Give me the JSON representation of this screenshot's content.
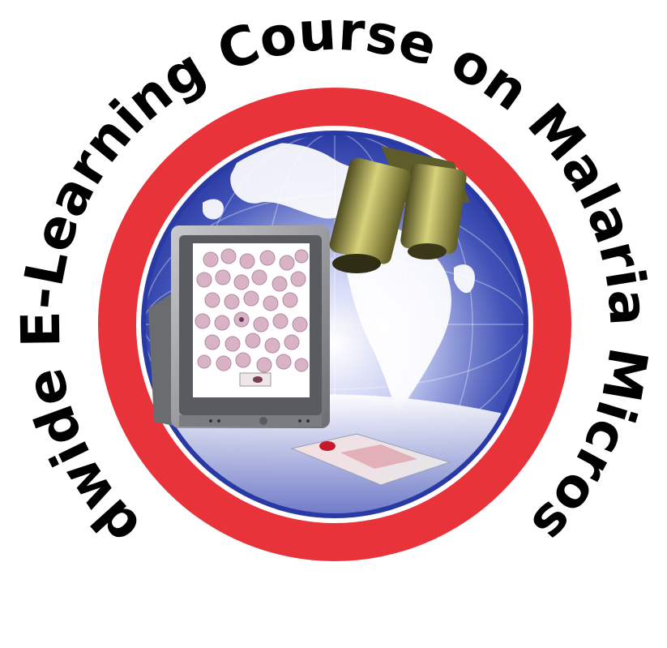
{
  "logo": {
    "title": "Worldwide E-Learning Course on Malaria Microscopy",
    "colors": {
      "ring": "#e8333b",
      "ring_inner_border": "#ffffff",
      "globe_deep": "#1f2f9a",
      "globe_light": "#c7cdf2",
      "land": "#ffffff",
      "monitor": "#8e8f95",
      "microscope": "#9f9a3c",
      "text": "#000000"
    },
    "icons": {
      "globe": "globe-icon",
      "monitor": "computer-monitor-icon",
      "microscope": "microscope-icon",
      "slide": "microscope-slide-icon",
      "blood_cells": "blood-cells-icon"
    }
  }
}
